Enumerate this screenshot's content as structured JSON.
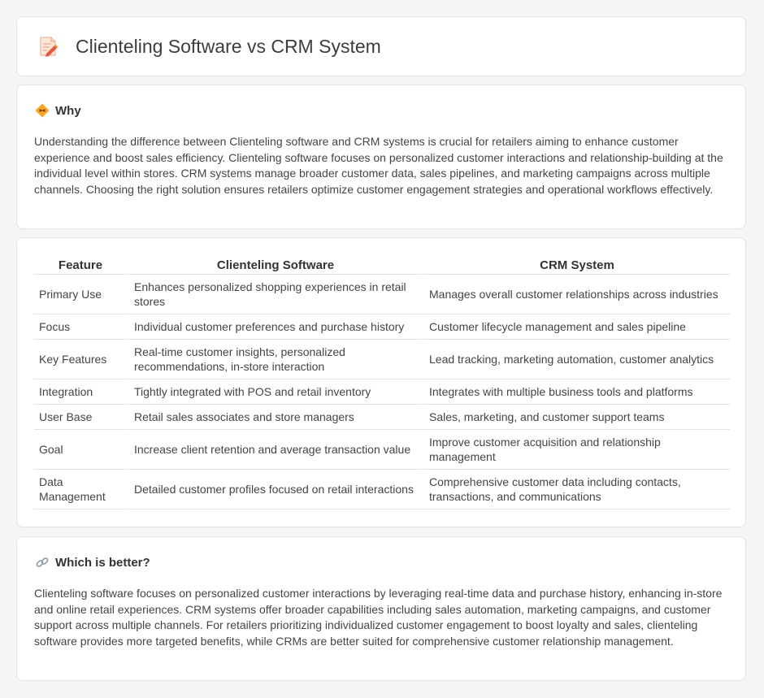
{
  "header": {
    "title": "Clienteling Software vs CRM System",
    "icon": "document-pencil-icon"
  },
  "why": {
    "title": "Why",
    "icon": "diamond-sign-icon",
    "text": "Understanding the difference between Clienteling software and CRM systems is crucial for retailers aiming to enhance customer experience and boost sales efficiency. Clienteling software focuses on personalized customer interactions and relationship-building at the individual level within stores. CRM systems manage broader customer data, sales pipelines, and marketing campaigns across multiple channels. Choosing the right solution ensures retailers optimize customer engagement strategies and operational workflows effectively."
  },
  "table": {
    "headers": [
      "Feature",
      "Clienteling Software",
      "CRM System"
    ],
    "rows": [
      [
        "Primary Use",
        "Enhances personalized shopping experiences in retail stores",
        "Manages overall customer relationships across industries"
      ],
      [
        "Focus",
        "Individual customer preferences and purchase history",
        "Customer lifecycle management and sales pipeline"
      ],
      [
        "Key Features",
        "Real-time customer insights, personalized recommendations, in-store interaction",
        "Lead tracking, marketing automation, customer analytics"
      ],
      [
        "Integration",
        "Tightly integrated with POS and retail inventory",
        "Integrates with multiple business tools and platforms"
      ],
      [
        "User Base",
        "Retail sales associates and store managers",
        "Sales, marketing, and customer support teams"
      ],
      [
        "Goal",
        "Increase client retention and average transaction value",
        "Improve customer acquisition and relationship management"
      ],
      [
        "Data Management",
        "Detailed customer profiles focused on retail interactions",
        "Comprehensive customer data including contacts, transactions, and communications"
      ]
    ]
  },
  "better": {
    "title": "Which is better?",
    "icon": "link-icon",
    "text": "Clienteling software focuses on personalized customer interactions by leveraging real-time data and purchase history, enhancing in-store and online retail experiences. CRM systems offer broader capabilities including sales automation, marketing campaigns, and customer support across multiple channels. For retailers prioritizing individualized customer engagement to boost loyalty and sales, clienteling software provides more targeted benefits, while CRMs are better suited for comprehensive customer relationship management."
  }
}
